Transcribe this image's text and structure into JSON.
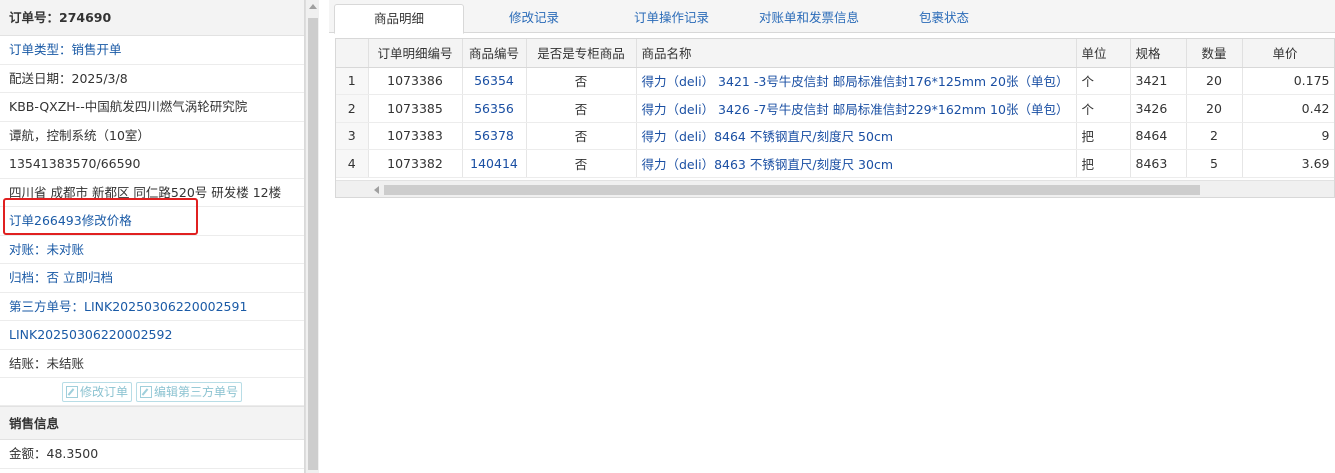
{
  "order": {
    "title": "订单号：274690",
    "fields": [
      {
        "label": "订单类型：",
        "value": "销售开单"
      },
      {
        "label": "配送日期：",
        "value": "2025/3/8"
      },
      {
        "label": "",
        "value": "KBB-QXZH--中国航发四川燃气涡轮研究院"
      },
      {
        "label": "",
        "value": "谭航，控制系统（10室）"
      },
      {
        "label": "",
        "value": "13541383570/66590"
      },
      {
        "label": "",
        "value": "四川省 成都市 新都区 同仁路520号 研发楼 12楼"
      },
      {
        "label": "",
        "value": "订单266493修改价格"
      },
      {
        "label": "对账：",
        "value": "未对账"
      },
      {
        "label": "归档：",
        "value": "否 立即归档"
      },
      {
        "label": "第三方单号：",
        "value": "LINK20250306220002591"
      },
      {
        "label": "",
        "value": "LINK20250306220002592"
      },
      {
        "label": "结账：",
        "value": "未结账"
      }
    ],
    "buttons": {
      "edit_order": "修改订单",
      "edit_third_party": "编辑第三方单号"
    },
    "sales_section": "销售信息",
    "amount_label": "金额：",
    "amount_value": "48.3500"
  },
  "tabs": [
    "商品明细",
    "修改记录",
    "订单操作记录",
    "对账单和发票信息",
    "包裹状态"
  ],
  "table": {
    "headers": [
      "",
      "订单明细编号",
      "商品编号",
      "是否是专柜商品",
      "商品名称",
      "单位",
      "规格",
      "数量",
      "单价"
    ],
    "rows": [
      {
        "idx": "1",
        "detail_id": "1073386",
        "product_id": "56354",
        "counter": "否",
        "name": "得力（deli） 3421 -3号牛皮信封 邮局标准信封176*125mm 20张（单包）",
        "unit": "个",
        "spec": "3421",
        "qty": "20",
        "price": "0.175"
      },
      {
        "idx": "2",
        "detail_id": "1073385",
        "product_id": "56356",
        "counter": "否",
        "name": "得力（deli） 3426 -7号牛皮信封 邮局标准信封229*162mm 10张（单包）",
        "unit": "个",
        "spec": "3426",
        "qty": "20",
        "price": "0.42"
      },
      {
        "idx": "3",
        "detail_id": "1073383",
        "product_id": "56378",
        "counter": "否",
        "name": "得力（deli）8464 不锈钢直尺/刻度尺 50cm",
        "unit": "把",
        "spec": "8464",
        "qty": "2",
        "price": "9"
      },
      {
        "idx": "4",
        "detail_id": "1073382",
        "product_id": "140414",
        "counter": "否",
        "name": "得力（deli）8463 不锈钢直尺/刻度尺 30cm",
        "unit": "把",
        "spec": "8463",
        "qty": "5",
        "price": "3.69"
      }
    ]
  },
  "colors": {
    "link": "#1a5aa6",
    "highlight": "#e02020"
  }
}
